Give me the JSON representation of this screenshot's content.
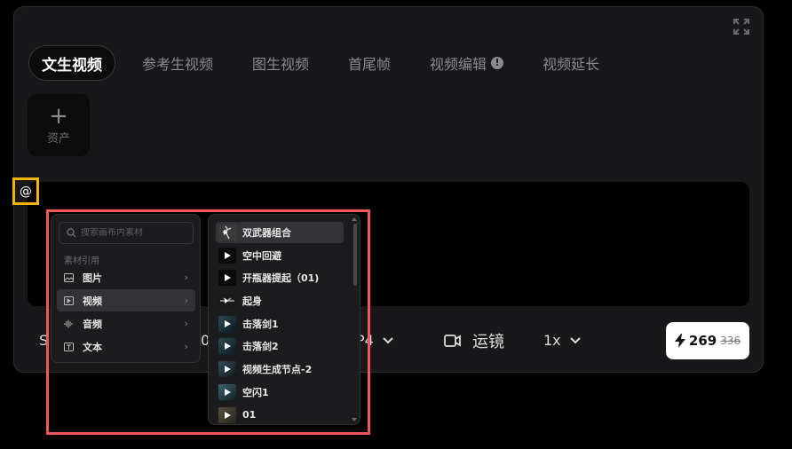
{
  "tabs": [
    {
      "label": "文生视频",
      "active": true
    },
    {
      "label": "参考生视频"
    },
    {
      "label": "图生视频"
    },
    {
      "label": "首尾帧"
    },
    {
      "label": "视频编辑",
      "warn": "!"
    },
    {
      "label": "视频延长"
    }
  ],
  "asset_button": {
    "icon": "plus-icon",
    "label": "资产"
  },
  "prompt": {
    "value": "@"
  },
  "bottom_bar": {
    "s_label": "S",
    "zero_label": "0",
    "format_label": "P4",
    "camera_icon": "video-camera-icon",
    "camera_label": "运镜",
    "speed_label": "1x",
    "credits": {
      "icon": "lightning-icon",
      "value": "269",
      "original": "336"
    }
  },
  "menu1": {
    "search_placeholder": "搜索画布内素材",
    "section_label": "素材引用",
    "items": [
      {
        "label": "图片",
        "icon": "image-icon"
      },
      {
        "label": "视频",
        "icon": "video-icon",
        "selected": true
      },
      {
        "label": "音频",
        "icon": "audio-icon"
      },
      {
        "label": "文本",
        "icon": "text-icon"
      }
    ]
  },
  "menu2": {
    "items": [
      {
        "label": "双武器组合",
        "selected": true
      },
      {
        "label": "空中回避"
      },
      {
        "label": "开瓶器提起（01)"
      },
      {
        "label": "起身"
      },
      {
        "label": "击落剑1"
      },
      {
        "label": "击落剑2"
      },
      {
        "label": "视频生成节点-2"
      },
      {
        "label": "空闪1"
      },
      {
        "label": "01"
      }
    ]
  },
  "colors": {
    "highlight": "#ee5a5a",
    "focus": "#f5b400"
  }
}
